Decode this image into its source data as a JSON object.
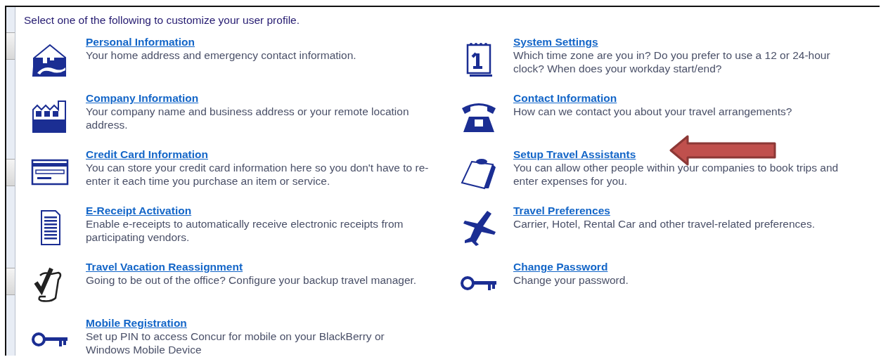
{
  "heading": "Select one of the following to customize your user profile.",
  "left_items": [
    {
      "title": "Personal Information",
      "description": "Your home address and emergency contact information."
    },
    {
      "title": "Company Information",
      "description": "Your company name and business address or your remote location address."
    },
    {
      "title": "Credit Card Information",
      "description": "You can store your credit card information here so you don't have to re-enter it each time you purchase an item or service."
    },
    {
      "title": "E-Receipt Activation",
      "description": "Enable e-receipts to automatically receive electronic receipts from participating vendors."
    },
    {
      "title": "Travel Vacation Reassignment",
      "description": "Going to be out of the office? Configure your backup travel manager."
    },
    {
      "title": "Mobile Registration",
      "description": "Set up PIN to access Concur for mobile on your BlackBerry or Windows Mobile Device"
    }
  ],
  "right_items": [
    {
      "title": "System Settings",
      "description": "Which time zone are you in? Do you prefer to use a 12 or 24-hour clock? When does your workday start/end?"
    },
    {
      "title": "Contact Information",
      "description": "How can we contact you about your travel arrangements?"
    },
    {
      "title": "Setup Travel Assistants",
      "description": "You can allow other people within your companies to book trips and enter expenses for you."
    },
    {
      "title": "Travel Preferences",
      "description": "Carrier, Hotel, Rental Car and other travel-related preferences."
    },
    {
      "title": "Change Password",
      "description": "Change your password."
    }
  ]
}
